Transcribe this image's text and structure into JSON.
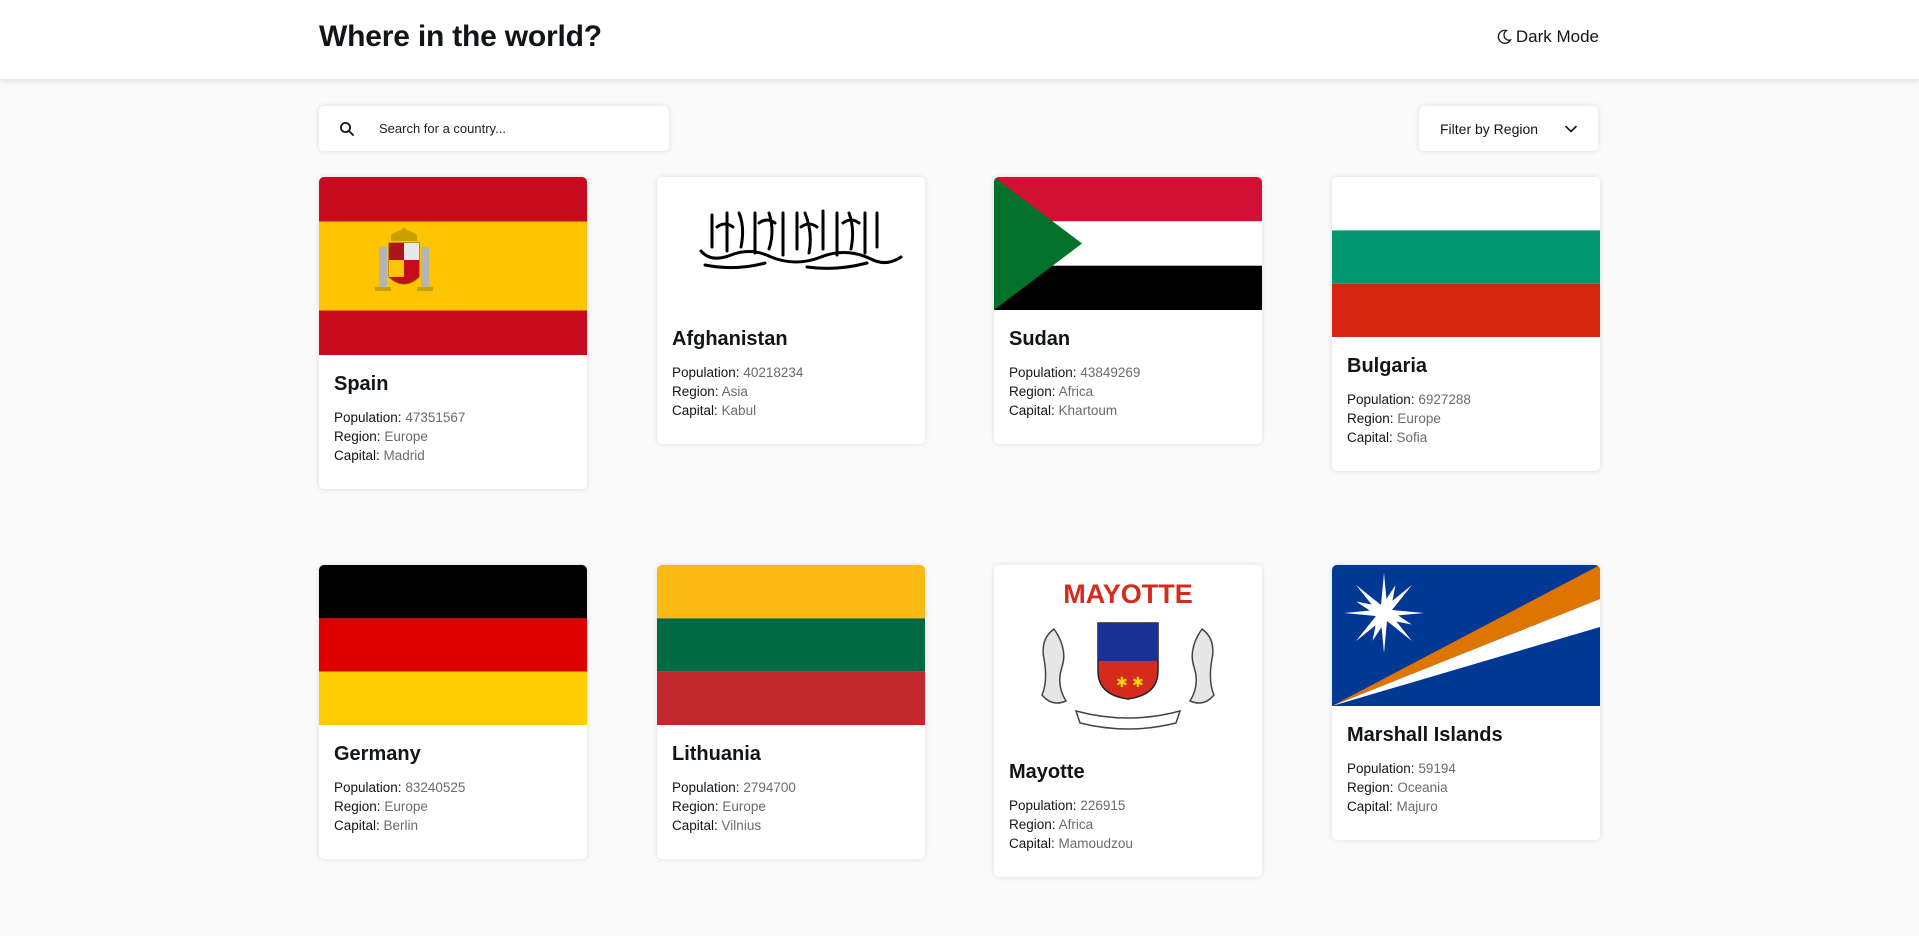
{
  "header": {
    "title": "Where in the world?",
    "dark_mode_label": "Dark Mode"
  },
  "search": {
    "placeholder": "Search for a country..."
  },
  "filter": {
    "label": "Filter by Region"
  },
  "labels": {
    "population": "Population:",
    "region": "Region:",
    "capital": "Capital:"
  },
  "countries": [
    {
      "name": "Spain",
      "population": "47351567",
      "region": "Europe",
      "capital": "Madrid"
    },
    {
      "name": "Afghanistan",
      "population": "40218234",
      "region": "Asia",
      "capital": "Kabul"
    },
    {
      "name": "Sudan",
      "population": "43849269",
      "region": "Africa",
      "capital": "Khartoum"
    },
    {
      "name": "Bulgaria",
      "population": "6927288",
      "region": "Europe",
      "capital": "Sofia"
    },
    {
      "name": "Germany",
      "population": "83240525",
      "region": "Europe",
      "capital": "Berlin"
    },
    {
      "name": "Lithuania",
      "population": "2794700",
      "region": "Europe",
      "capital": "Vilnius"
    },
    {
      "name": "Mayotte",
      "population": "226915",
      "region": "Africa",
      "capital": "Mamoudzou",
      "flag_text": "MAYOTTE"
    },
    {
      "name": "Marshall Islands",
      "population": "59194",
      "region": "Oceania",
      "capital": "Majuro"
    }
  ],
  "colors": {
    "background": "#fafafa",
    "card": "#ffffff",
    "text": "#111517",
    "muted": "#6b6b6b"
  }
}
